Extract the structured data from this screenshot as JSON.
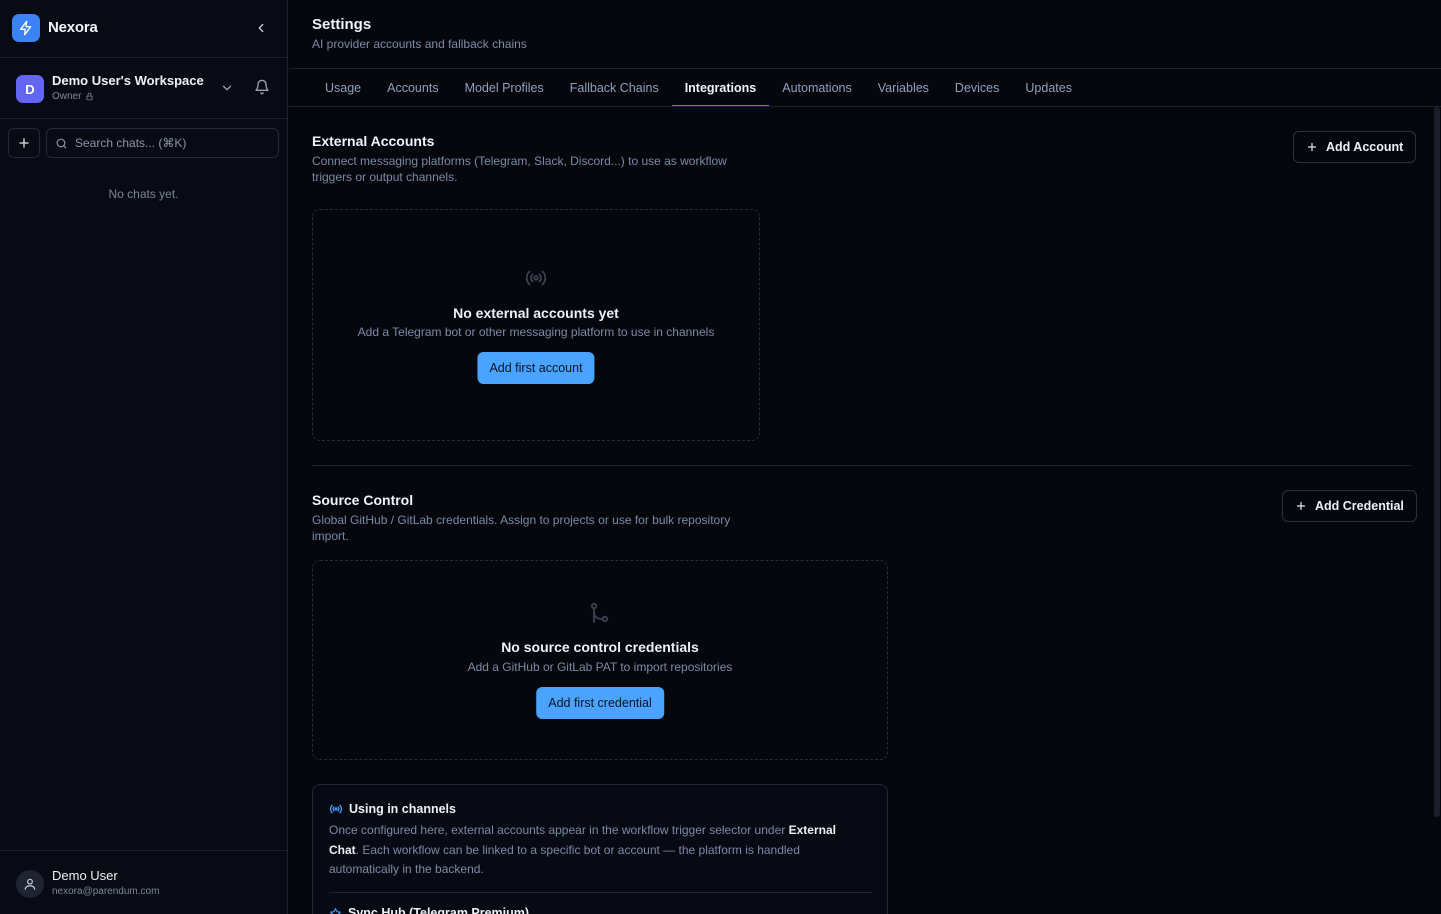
{
  "app": {
    "name": "Nexora"
  },
  "workspace": {
    "initial": "D",
    "name": "Demo User's Workspace",
    "role": "Owner"
  },
  "sidebar": {
    "search_placeholder": "Search chats... (⌘K)",
    "empty_text": "No chats yet."
  },
  "user": {
    "name": "Demo User",
    "email": "nexora@parendum.com"
  },
  "page": {
    "title": "Settings",
    "subtitle": "AI provider accounts and fallback chains"
  },
  "tabs": [
    {
      "label": "Usage",
      "active": false
    },
    {
      "label": "Accounts",
      "active": false
    },
    {
      "label": "Model Profiles",
      "active": false
    },
    {
      "label": "Fallback Chains",
      "active": false
    },
    {
      "label": "Integrations",
      "active": true
    },
    {
      "label": "Automations",
      "active": false
    },
    {
      "label": "Variables",
      "active": false
    },
    {
      "label": "Devices",
      "active": false
    },
    {
      "label": "Updates",
      "active": false
    }
  ],
  "external_accounts": {
    "title": "External Accounts",
    "description": "Connect messaging platforms (Telegram, Slack, Discord...) to use as workflow triggers or output channels.",
    "add_button": "Add Account",
    "empty_title": "No external accounts yet",
    "empty_sub": "Add a Telegram bot or other messaging platform to use in channels",
    "empty_button": "Add first account",
    "icon": "radio-broadcast-icon"
  },
  "source_control": {
    "title": "Source Control",
    "description": "Global GitHub / GitLab credentials. Assign to projects or use for bulk repository import.",
    "add_button": "Add Credential",
    "empty_title": "No source control credentials",
    "empty_sub": "Add a GitHub or GitLab PAT to import repositories",
    "empty_button": "Add first credential",
    "icon": "git-branch-icon"
  },
  "info": {
    "heading": "Using in channels",
    "body_pre": "Once configured here, external accounts appear in the workflow trigger selector under ",
    "body_bold": "External Chat",
    "body_post": ". Each workflow can be linked to a specific bot or account — the platform is handled automatically in the backend.",
    "heading2": "Sync Hub (Telegram Premium)"
  },
  "colors": {
    "accent": "#3b82f6",
    "primary_button": "#4aa3ff",
    "workspace_avatar": "#6366f1",
    "background": "#05070d"
  }
}
